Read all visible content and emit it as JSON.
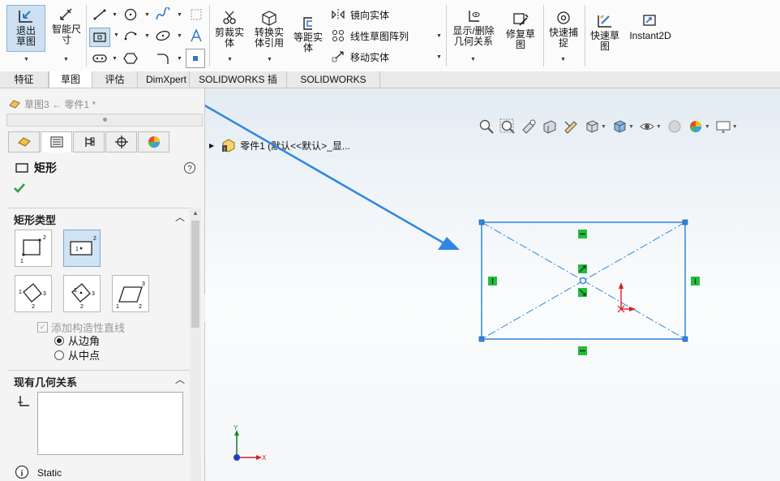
{
  "ribbon": {
    "exit_sketch": "退出草图",
    "smart_dimension": "智能尺寸",
    "trim_entities": "剪裁实体",
    "convert_entities": "转换实体引用",
    "offset_entities": "等距实体",
    "mirror_entities": "镜向实体",
    "linear_pattern": "线性草图阵列",
    "move_entities": "移动实体",
    "display_delete_relations": "显示/删除几何关系",
    "repair_sketch": "修复草图",
    "quick_snaps": "快速捕捉",
    "rapid_sketch": "快速草图",
    "instant2d": "Instant2D"
  },
  "tabs": [
    "特征",
    "草图",
    "评估",
    "DimXpert",
    "SOLIDWORKS 插件",
    "SOLIDWORKS MBD"
  ],
  "breadcrumb": "草图3 ← 零件1 *",
  "property_manager": {
    "title": "矩形",
    "rect_type_heading": "矩形类型",
    "add_construction_lines": "添加构造性直线",
    "from_corner": "从边角",
    "from_midpoint": "从中点",
    "existing_relations_heading": "现有几何关系",
    "status_text": "Static"
  },
  "tree": {
    "part_label": "零件1  (默认<<默认>_显..."
  },
  "triad": {
    "x": "X",
    "y": "Y"
  },
  "colors": {
    "accent": "#2d78c8",
    "sketch_line": "#2f86e0",
    "relation_marker": "#1fbf3a",
    "origin_red": "#e01b1b",
    "arrow_blue": "#2f86e0"
  },
  "icons": [
    "exit-sketch-icon",
    "smart-dimension-icon",
    "line-icon",
    "rectangle-icon",
    "slot-icon",
    "circle-icon",
    "arc-icon",
    "polygon-icon",
    "spline-icon",
    "ellipse-icon",
    "fillet-icon",
    "plane-icon",
    "text-icon",
    "point-icon",
    "trim-icon",
    "convert-icon",
    "offset-icon",
    "mirror-icon",
    "linear-pattern-icon",
    "move-icon",
    "relations-icon",
    "repair-icon",
    "quick-snap-icon",
    "rapid-sketch-icon",
    "instant2d-icon",
    "help-icon",
    "check-icon"
  ]
}
